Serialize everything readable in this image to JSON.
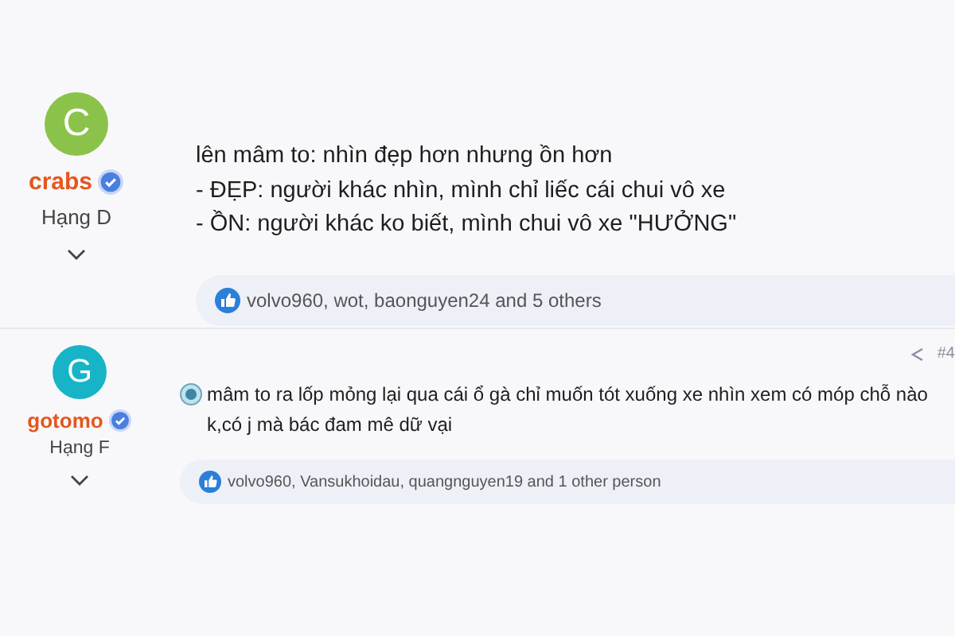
{
  "posts": [
    {
      "author": {
        "initial": "C",
        "color": "#8bc34a",
        "name": "crabs",
        "rank": "Hạng D"
      },
      "emoji": false,
      "lines": [
        "lên mâm to: nhìn đẹp hơn nhưng ồn hơn",
        "- ĐẸP: người khác nhìn, mình chỉ liếc cái chui vô xe",
        "- ỒN: người khác ko biết, mình chui vô xe \"HƯỞNG\""
      ],
      "reactions": "volvo960, wot, baonguyen24 and 5 others"
    },
    {
      "number": "#4",
      "author": {
        "initial": "G",
        "color": "#17b4c8",
        "name": "gotomo",
        "rank": "Hạng F"
      },
      "emoji": true,
      "lines": [
        "mâm to ra lốp mỏng lại qua cái ổ gà chỉ muốn tót xuống xe nhìn xem có móp chỗ nào k,có j mà bác đam mê dữ vại"
      ],
      "reactions": "volvo960, Vansukhoidau, quangnguyen19 and 1 other person"
    }
  ]
}
